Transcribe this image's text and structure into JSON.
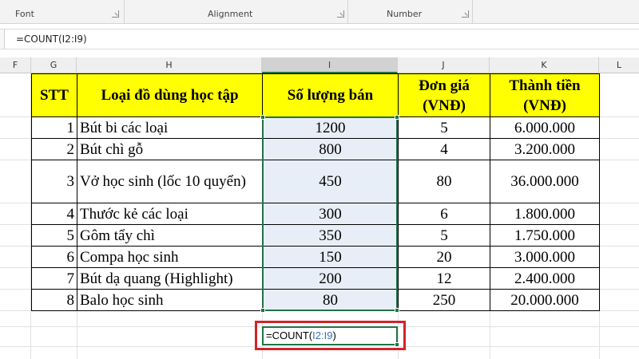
{
  "ribbon": {
    "groups": [
      "Font",
      "Alignment",
      "Number"
    ]
  },
  "formula_bar": {
    "formula": "=COUNT(I2:I9)"
  },
  "columns": [
    "F",
    "G",
    "H",
    "I",
    "J",
    "K",
    "L"
  ],
  "selected_column": "I",
  "table": {
    "headers": [
      "STT",
      "Loại đồ dùng học tập",
      "Số lượng bán",
      "Đơn giá (VNĐ)",
      "Thành tiền (VNĐ)"
    ],
    "rows": [
      [
        "1",
        "Bút bi các loại",
        "1200",
        "5",
        "6.000.000"
      ],
      [
        "2",
        "Bút chì gỗ",
        "800",
        "4",
        "3.200.000"
      ],
      [
        "3",
        "Vở học sinh (lốc 10 quyển)",
        "450",
        "80",
        "36.000.000"
      ],
      [
        "4",
        "Thước kẻ các loại",
        "300",
        "6",
        "1.800.000"
      ],
      [
        "5",
        "Gôm tẩy chì",
        "350",
        "5",
        "1.750.000"
      ],
      [
        "6",
        "Compa học sinh",
        "150",
        "20",
        "3.000.000"
      ],
      [
        "7",
        "Bút dạ quang (Highlight)",
        "200",
        "12",
        "2.400.000"
      ],
      [
        "8",
        "Balo học sinh",
        "80",
        "250",
        "20.000.000"
      ]
    ]
  },
  "active_cell": {
    "func": "=COUNT(",
    "ref": "I2:I9",
    "close": ")"
  },
  "colors": {
    "header_fill": "#ffff00",
    "selection": "#217346",
    "selected_range_fill": "#e8eef8",
    "callout": "#d2232a"
  }
}
